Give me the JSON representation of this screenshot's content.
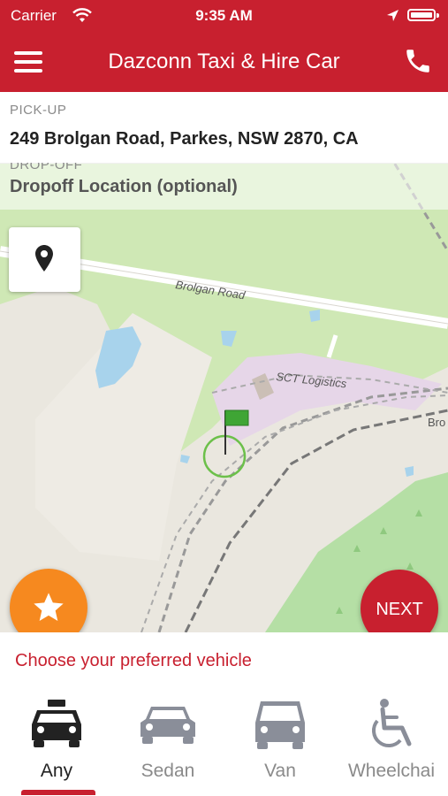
{
  "status_bar": {
    "carrier": "Carrier",
    "time": "9:35 AM"
  },
  "header": {
    "title": "Dazconn Taxi & Hire Car",
    "menu_icon": "menu-icon",
    "phone_icon": "phone-icon"
  },
  "pickup": {
    "label": "PICK-UP",
    "value": "249 Brolgan Road, Parkes, NSW 2870, CA"
  },
  "dropoff": {
    "label": "DROP-OFF",
    "value": "Dropoff Location (optional)"
  },
  "map": {
    "labels": {
      "road": "Brolgan Road",
      "poi": "SCT Logistics",
      "edge": "Bro"
    },
    "colors": {
      "land": "#eae7df",
      "park": "#cfe8b5",
      "industrial": "#e6d6e8",
      "water": "#a8d3ec",
      "forest": "#b5dfa5"
    }
  },
  "buttons": {
    "next": "NEXT",
    "favorite_icon": "star-icon",
    "locate_icon": "map-pin-icon"
  },
  "vehicle_prompt": "Choose your preferred vehicle",
  "vehicles": [
    {
      "label": "Any",
      "icon": "taxi-icon",
      "selected": true
    },
    {
      "label": "Sedan",
      "icon": "sedan-icon",
      "selected": false
    },
    {
      "label": "Van",
      "icon": "van-icon",
      "selected": false
    },
    {
      "label": "Wheelchai",
      "icon": "wheelchair-icon",
      "selected": false
    }
  ],
  "accent_color": "#c8202f",
  "favorite_color": "#f6891f"
}
